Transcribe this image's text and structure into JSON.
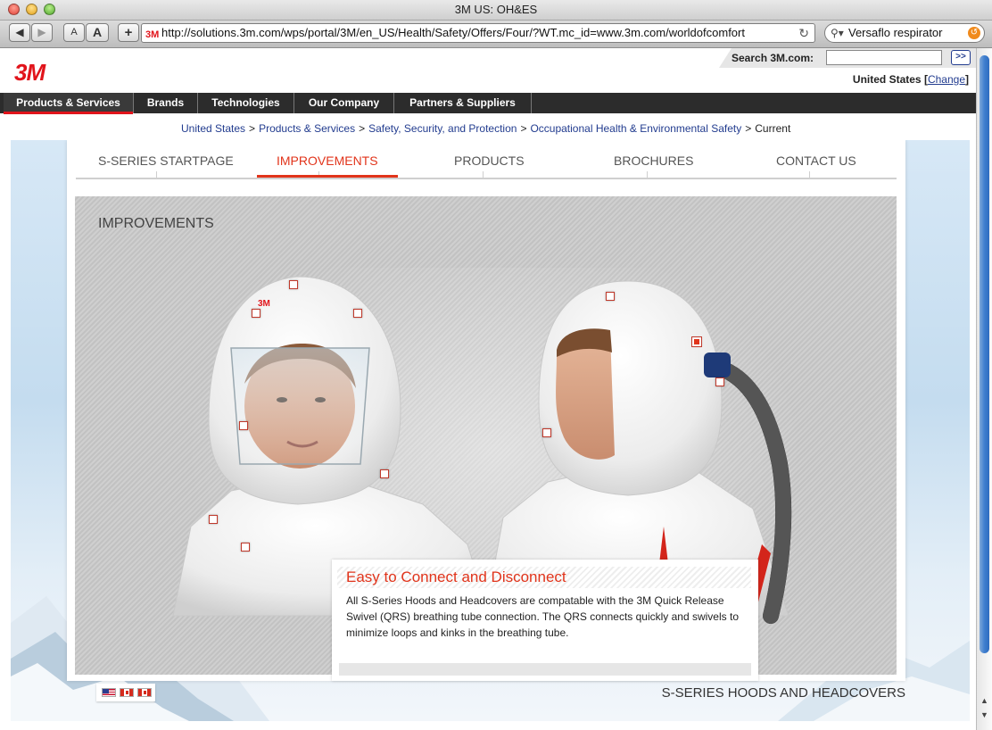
{
  "window": {
    "title": "3M US: OH&ES"
  },
  "browser": {
    "url": "http://solutions.3m.com/wps/portal/3M/en_US/Health/Safety/Offers/Four/?WT.mc_id=www.3m.com/worldofcomfort",
    "url_favicon": "3M",
    "search_value": "Versaflo respirator",
    "text_smaller": "A",
    "text_larger": "A",
    "add_bookmark": "+"
  },
  "header": {
    "logo": "3M",
    "search_label": "Search 3M.com:",
    "search_go": ">>",
    "country": "United States",
    "change_label": "Change"
  },
  "mainnav": {
    "items": [
      "Products & Services",
      "Brands",
      "Technologies",
      "Our Company",
      "Partners & Suppliers"
    ],
    "active": "Products & Services"
  },
  "breadcrumb": {
    "items": [
      "United States",
      "Products & Services",
      "Safety, Security, and Protection",
      "Occupational Health & Environmental Safety"
    ],
    "current": "Current",
    "separator": ">"
  },
  "subnav": {
    "items": [
      "S-SERIES STARTPAGE",
      "IMPROVEMENTS",
      "PRODUCTS",
      "BROCHURES",
      "CONTACT US"
    ],
    "active": "IMPROVEMENTS"
  },
  "hero": {
    "title": "IMPROVEMENTS",
    "hood_logo": "3M"
  },
  "info": {
    "title": "Easy to Connect and Disconnect",
    "body": "All S-Series Hoods and Headcovers are compatable with the 3M Quick Release Swivel (QRS) breathing tube connection.  The QRS connects quickly and swivels to minimize loops and kinks in the breathing tube."
  },
  "footer": {
    "title": "S-SERIES HOODS AND HEADCOVERS"
  },
  "colors": {
    "brand_red": "#e1141b",
    "link_blue": "#223c8f",
    "accent": "#e1341b"
  }
}
